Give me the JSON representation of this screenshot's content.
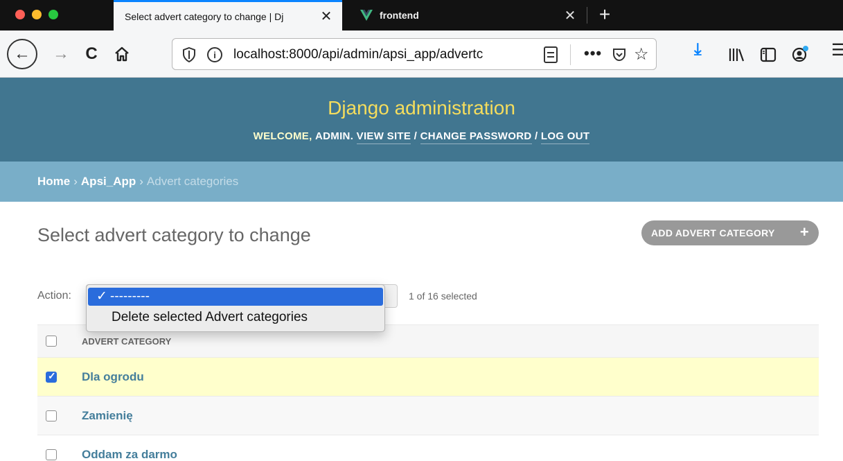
{
  "browser": {
    "tabs": [
      {
        "title": "Select advert category to change | Dj",
        "active": true
      },
      {
        "title": "frontend",
        "active": false
      }
    ],
    "new_tab_symbol": "+",
    "close_symbol": "✕",
    "url": {
      "host": "localhost",
      "path": ":8000/api/admin/apsi_app/advertc"
    },
    "back_symbol": "←",
    "forward_symbol": "→",
    "reload_symbol": "C",
    "more_symbol": "•••",
    "star_symbol": "☆",
    "download_symbol": "⤓",
    "menu_symbol": "☰",
    "info_symbol": "i"
  },
  "header": {
    "brand": "Django administration",
    "welcome": "Welcome,",
    "user": "admin",
    "view_site": "View site",
    "change_password": "Change password",
    "log_out": "Log out"
  },
  "breadcrumbs": {
    "home": "Home",
    "app": "Apsi_App",
    "current": "Advert categories",
    "separator": "›"
  },
  "content": {
    "title": "Select advert category to change",
    "add_button": "ADD ADVERT CATEGORY",
    "add_plus": "+",
    "action_label": "Action:",
    "selected_count": "1 of 16 selected",
    "dropdown": {
      "check": "✓",
      "options": [
        "---------",
        "Delete selected Advert categories"
      ]
    },
    "table": {
      "column_header": "Advert category",
      "rows": [
        {
          "label": "Dla ogrodu",
          "checked": true
        },
        {
          "label": "Zamienię",
          "checked": false
        },
        {
          "label": "Oddam za darmo",
          "checked": false
        }
      ]
    }
  },
  "colors": {
    "header_bg": "#417690",
    "brand": "#f5dd5d",
    "breadcrumb_bg": "#79aec8",
    "link": "#447e9b",
    "selected_row": "#ffffcc",
    "active_option": "#2a6cdc"
  }
}
